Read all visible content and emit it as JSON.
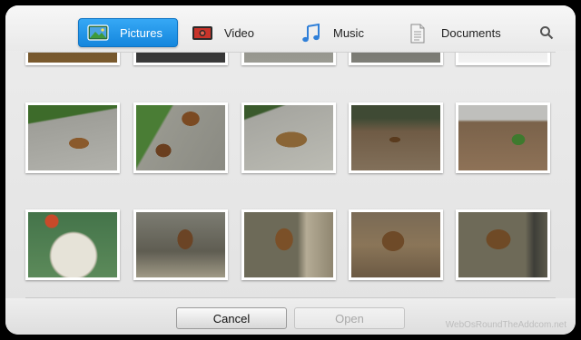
{
  "tabs": [
    {
      "label": "Pictures",
      "icon": "pictures-icon",
      "active": true
    },
    {
      "label": "Video",
      "icon": "video-icon",
      "active": false
    },
    {
      "label": "Music",
      "icon": "music-icon",
      "active": false
    },
    {
      "label": "Documents",
      "icon": "documents-icon",
      "active": false
    }
  ],
  "search": {
    "icon": "search-icon"
  },
  "colors": {
    "accent": "#1a8ee6",
    "background": "#e6e6e6",
    "disabled_text": "#a8a8a8"
  },
  "thumbnails": {
    "partial_row": [
      "#7a5a2e",
      "#2b2b2b",
      "#8c8c86",
      "#6f6f6a",
      "#e8e8e8"
    ],
    "row_1": [
      "dog on concrete path",
      "two dogs in grass",
      "sleeping dog",
      "dirt yard",
      "dog near plant"
    ],
    "row_2": [
      "food plate",
      "dog in leaves",
      "dog in leaves close",
      "dog on dirt",
      "dog by wall"
    ]
  },
  "footer": {
    "cancel_label": "Cancel",
    "open_label": "Open",
    "watermark": "WebOsRoundTheAddcom.net"
  }
}
